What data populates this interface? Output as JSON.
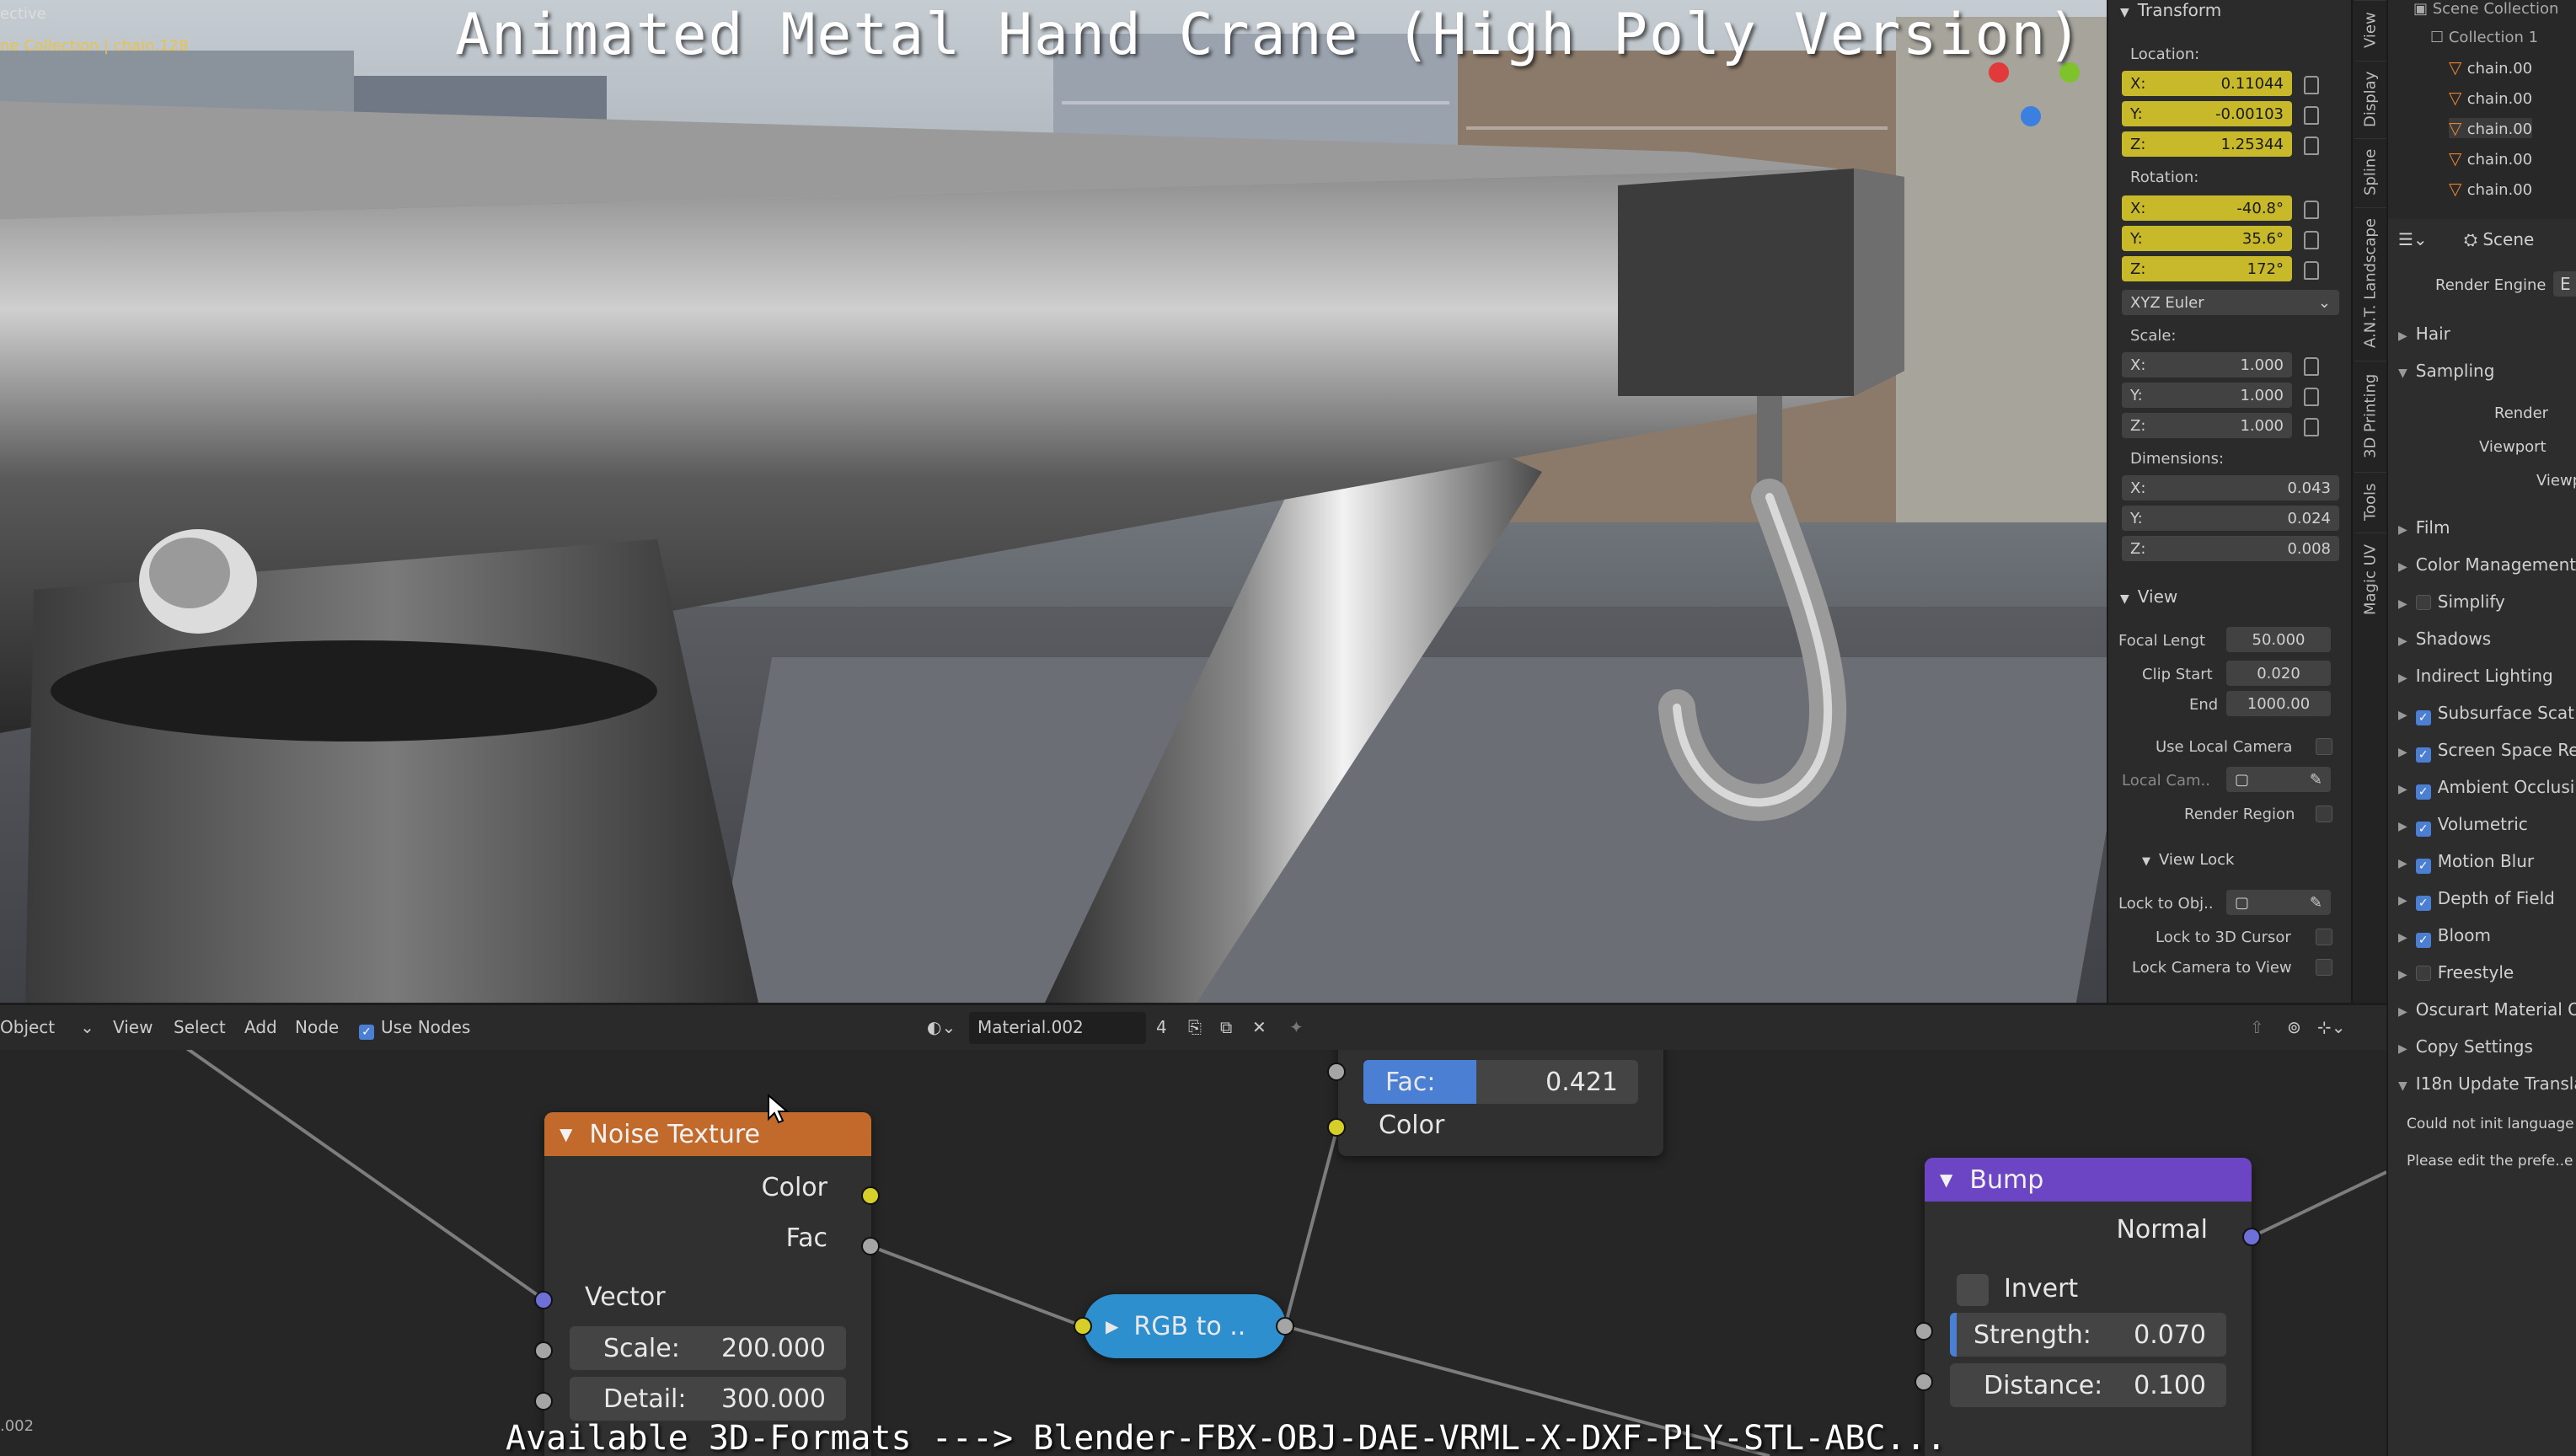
{
  "viewport": {
    "title": "Animated Metal Hand Crane (High Poly Version)",
    "mode_label": "ective",
    "collection_label": "ne Collection | chain.128"
  },
  "transform": {
    "header": "Transform",
    "location_label": "Location:",
    "location": {
      "x": "0.11044",
      "y": "-0.00103",
      "z": "1.25344"
    },
    "rotation_label": "Rotation:",
    "rotation": {
      "x": "-40.8°",
      "y": "35.6°",
      "z": "172°"
    },
    "rotation_mode": "XYZ Euler",
    "scale_label": "Scale:",
    "scale": {
      "x": "1.000",
      "y": "1.000",
      "z": "1.000"
    },
    "dimensions_label": "Dimensions:",
    "dimensions": {
      "x": "0.043",
      "y": "0.024",
      "z": "0.008"
    },
    "axis": {
      "x": "X:",
      "y": "Y:",
      "z": "Z:"
    }
  },
  "view": {
    "header": "View",
    "focal_label": "Focal Lengt",
    "focal": "50.000",
    "clip_start_label": "Clip Start",
    "clip_start": "0.020",
    "clip_end_label": "End",
    "clip_end": "1000.00",
    "use_local_camera": "Use Local Camera",
    "local_cam": "Local Cam..",
    "render_region": "Render Region",
    "view_lock_header": "View Lock",
    "lock_to_obj": "Lock to Obj..",
    "lock_to_cursor": "Lock to 3D Cursor",
    "lock_camera": "Lock Camera to View"
  },
  "vtabs": [
    "View",
    "Display",
    "Spline",
    "A.N.T. Landscape",
    "3D Printing",
    "Tools",
    "Magic UV"
  ],
  "outliner": {
    "header": "Scene Collection",
    "collection": "Collection 1",
    "items": [
      "chain.00",
      "chain.00",
      "chain.00",
      "chain.00",
      "chain.00"
    ]
  },
  "properties": {
    "scene_tab": "Scene",
    "render_engine_label": "Render Engine",
    "render_engine_value": "E",
    "hair": "Hair",
    "sampling": "Sampling",
    "render": "Render",
    "viewport": "Viewport",
    "viewp": "Viewp",
    "film": "Film",
    "color_management": "Color Management",
    "simplify": "Simplify",
    "shadows": "Shadows",
    "indirect_lighting": "Indirect Lighting",
    "subsurface": "Subsurface Scat",
    "screen_space": "Screen Space Re",
    "ambient": "Ambient Occlusi",
    "volumetric": "Volumetric",
    "motion_blur": "Motion Blur",
    "depth_of_field": "Depth of Field",
    "bloom": "Bloom",
    "freestyle": "Freestyle",
    "oscurart": "Oscurart Material O",
    "copy_settings": "Copy Settings",
    "i18n": "I18n Update Transla",
    "msg1": "Could not init language",
    "msg2": "Please edit the prefe..e"
  },
  "node_header": {
    "object": "Object",
    "view": "View",
    "select": "Select",
    "add": "Add",
    "node": "Node",
    "use_nodes": "Use Nodes",
    "material": "Material.002",
    "users": "4"
  },
  "nodes": {
    "noise": {
      "title": "Noise Texture",
      "color": "Color",
      "fac": "Fac",
      "vector": "Vector",
      "scale_label": "Scale:",
      "scale": "200.000",
      "detail_label": "Detail:",
      "detail": "300.000"
    },
    "mix": {
      "fac_label": "Fac:",
      "fac": "0.421",
      "color": "Color"
    },
    "rgb": {
      "title": "RGB to .."
    },
    "bump": {
      "title": "Bump",
      "normal": "Normal",
      "invert": "Invert",
      "strength_label": "Strength:",
      "strength": "0.070",
      "distance_label": "Distance:",
      "distance": "0.100"
    }
  },
  "status_left": ".002",
  "subtitle": "Available 3D-Formats ---> Blender-FBX-OBJ-DAE-VRML-X-DXF-PLY-STL-ABC..."
}
